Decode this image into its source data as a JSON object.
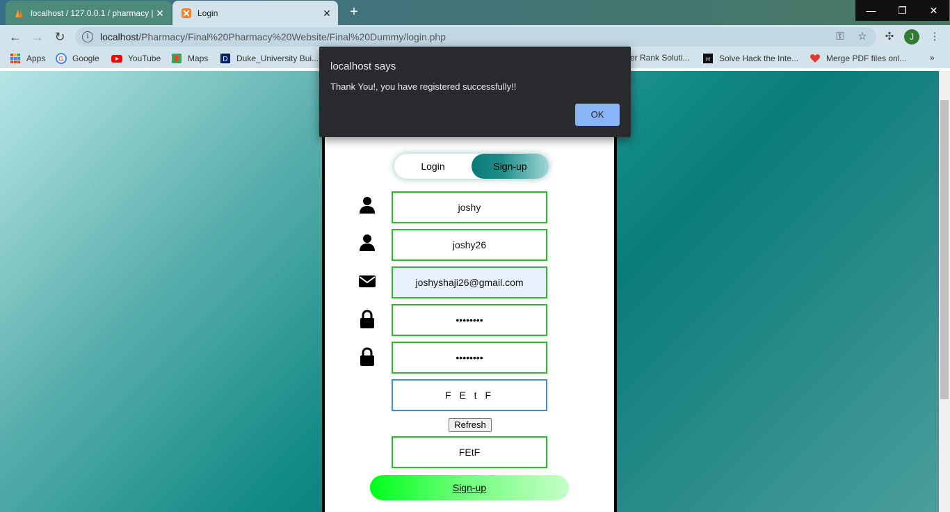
{
  "browser": {
    "tabs": [
      {
        "title": "localhost / 127.0.0.1 / pharmacy |",
        "active": false
      },
      {
        "title": "Login",
        "active": true
      }
    ],
    "new_tab": "+",
    "window_controls": {
      "minimize": "—",
      "maximize": "❐",
      "close": "✕"
    },
    "url_host": "localhost",
    "url_path": "/Pharmacy/Final%20Pharmacy%20Website/Final%20Dummy/login.php",
    "profile_initial": "J",
    "bookmarks": [
      {
        "label": "Apps",
        "icon": "apps-grid-icon"
      },
      {
        "label": "Google",
        "icon": "google-icon"
      },
      {
        "label": "YouTube",
        "icon": "youtube-icon"
      },
      {
        "label": "Maps",
        "icon": "maps-icon"
      },
      {
        "label": "Duke_University Bui...",
        "icon": "duke-icon"
      },
      {
        "label": "er Rank Soluti...",
        "icon": "none"
      },
      {
        "label": "Solve Hack the Inte...",
        "icon": "hackerearth-icon"
      },
      {
        "label": "Merge PDF files onl...",
        "icon": "heart-icon"
      }
    ],
    "bookmarks_more": "»"
  },
  "dialog": {
    "title": "localhost says",
    "message": "Thank You!, you have registered successfully!!",
    "ok_label": "OK"
  },
  "form": {
    "toggle": {
      "login_label": "Login",
      "signup_label": "Sign-up"
    },
    "fields": {
      "name": "joshy",
      "username": "joshy26",
      "email": "joshyshaji26@gmail.com",
      "password": "••••••••",
      "confirm_password": "••••••••",
      "captcha_text": "F E t F",
      "captcha_input": "FEtF"
    },
    "refresh_label": "Refresh",
    "submit_label": "Sign-up"
  },
  "colors": {
    "field_border": "#22c322",
    "captcha_border": "#3b8ed3",
    "dialog_bg": "#292a2d",
    "dialog_ok": "#8ab4f8"
  }
}
